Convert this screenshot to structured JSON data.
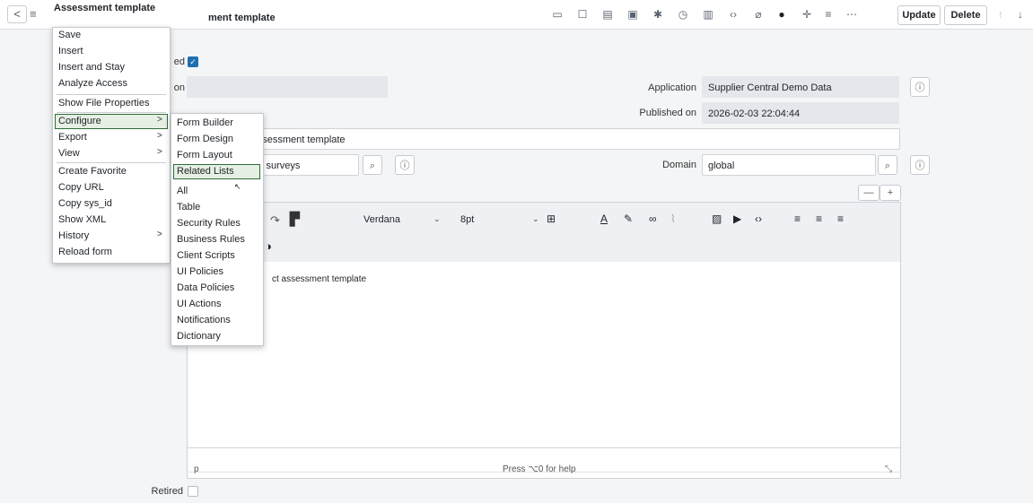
{
  "header": {
    "back_label": "<",
    "title": "Assessment template",
    "subtitle": "ment template",
    "update_label": "Update",
    "delete_label": "Delete",
    "toolbar_icons": [
      "comment-icon",
      "chat-icon",
      "save-icon",
      "form-icon",
      "bug-icon",
      "history-icon",
      "attachment-doc-icon",
      "code-icon",
      "paperclip-icon",
      "help-icon",
      "pin-icon",
      "settings-icon",
      "more-icon"
    ]
  },
  "form": {
    "published_label_partial": "ed",
    "description_label_partial": "on",
    "application_label": "Application",
    "application_value": "Supplier Central Demo Data",
    "published_on_label": "Published on",
    "published_on_value": "2026-02-03 22:04:44",
    "name_value_partial": "ct assessment template",
    "survey_value_partial": "ment surveys",
    "domain_label": "Domain",
    "domain_value": "global",
    "retired_label": "Retired"
  },
  "editor": {
    "font": "Verdana",
    "size": "8pt",
    "content": "ct assessment template",
    "path": "p",
    "help": "Press ⌥0 for help"
  },
  "context_menu": {
    "items": [
      "Save",
      "Insert",
      "Insert and Stay",
      "Analyze Access",
      "Show File Properties",
      "Configure",
      "Export",
      "View",
      "Create Favorite",
      "Copy URL",
      "Copy sys_id",
      "Show XML",
      "History",
      "Reload form"
    ]
  },
  "configure_submenu": {
    "items": [
      "Form Builder",
      "Form Design",
      "Form Layout",
      "Related Lists",
      "All",
      "Table",
      "Security Rules",
      "Business Rules",
      "Client Scripts",
      "UI Policies",
      "Data Policies",
      "UI Actions",
      "Notifications",
      "Dictionary"
    ]
  },
  "colors": {
    "accent": "#2e6b3a",
    "checkbox": "#1f6fb2",
    "readonly": "#e4e7ec"
  }
}
